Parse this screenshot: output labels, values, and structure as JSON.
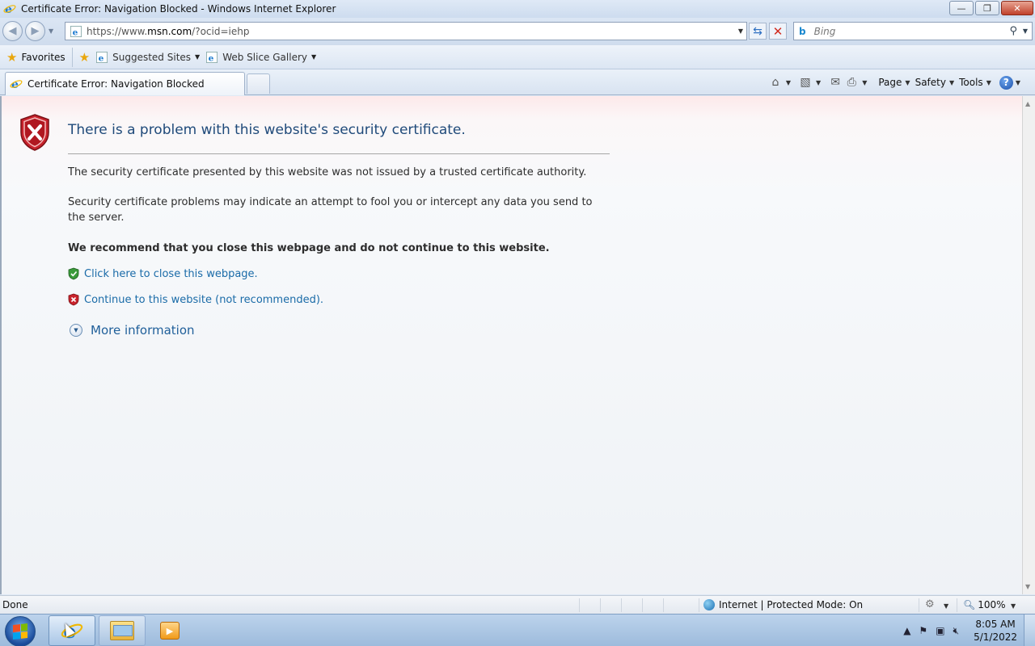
{
  "window": {
    "title": "Certificate Error: Navigation Blocked - Windows Internet Explorer",
    "controls": {
      "minimize": "—",
      "restore": "❐",
      "close": "✕"
    }
  },
  "navigation": {
    "back_glyph": "◀",
    "forward_glyph": "▶",
    "address_prefix": "https://www.",
    "address_host": "msn.com",
    "address_suffix": "/?ocid=iehp",
    "search_brand": "b",
    "search_placeholder": "Bing",
    "search_glyph": "⚲"
  },
  "favorites_bar": {
    "favorites_label": "Favorites",
    "links": [
      {
        "label": "Suggested Sites"
      },
      {
        "label": "Web Slice Gallery"
      }
    ]
  },
  "tabs": {
    "active_label": "Certificate Error: Navigation Blocked"
  },
  "command_bar": {
    "icons": [
      "home-icon",
      "feeds-icon",
      "read-mail-icon",
      "print-icon"
    ],
    "menus": [
      {
        "label": "Page"
      },
      {
        "label": "Safety"
      },
      {
        "label": "Tools"
      }
    ],
    "help_glyph": "?"
  },
  "error_page": {
    "heading": "There is a problem with this website's security certificate.",
    "para1": "The security certificate presented by this website was not issued by a trusted certificate authority.",
    "para2": "Security certificate problems may indicate an attempt to fool you or intercept any data you send to the server.",
    "recommendation": "We recommend that you close this webpage and do not continue to this website.",
    "close_link": "Click here to close this webpage.",
    "continue_link": "Continue to this website (not recommended).",
    "more_info": "More information",
    "colors": {
      "heading": "#1f4a7a",
      "link": "#1a6ba8",
      "shield_red": "#c8232c",
      "shield_green": "#3a9a3a"
    }
  },
  "status_bar": {
    "status": "Done",
    "zone": "Internet | Protected Mode: On",
    "zoom": "100%"
  },
  "taskbar": {
    "apps": [
      "internet-explorer",
      "windows-explorer",
      "media-player"
    ],
    "tray_arrow": "▲",
    "time": "8:05 AM",
    "date": "5/1/2022"
  }
}
